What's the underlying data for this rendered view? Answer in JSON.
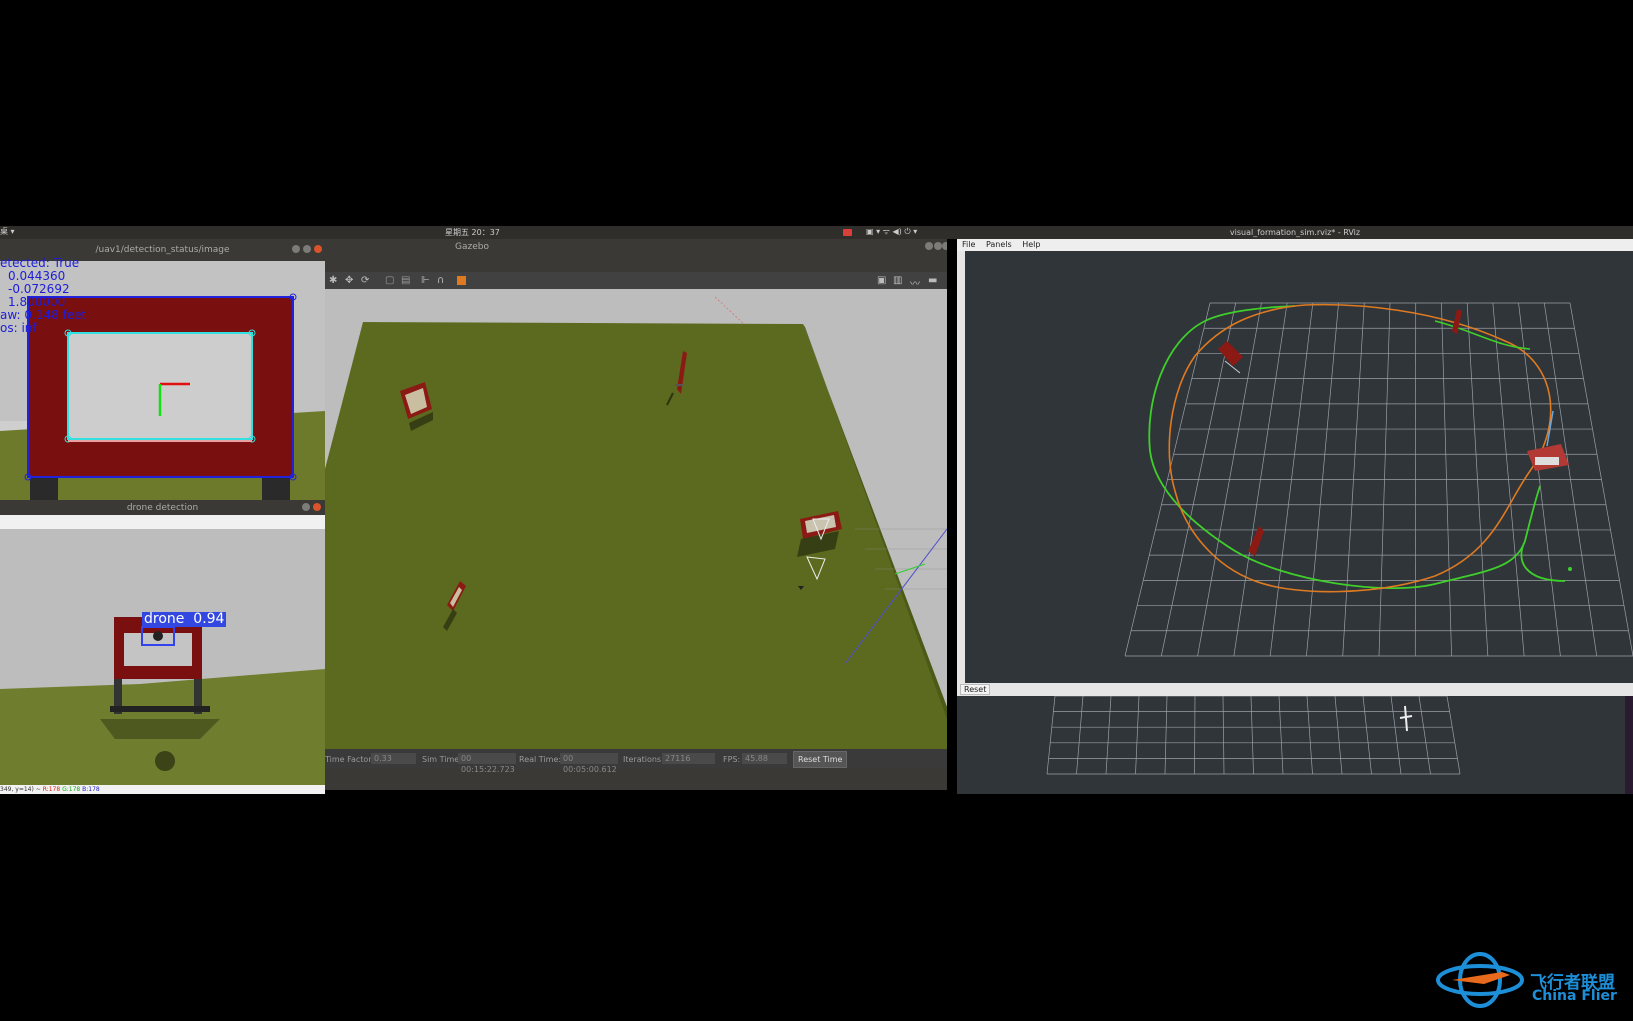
{
  "topbar": {
    "left_menu": "桌 ▾",
    "clock": "星期五 20：37",
    "tray_glyphs": "▣ ▾  ᯤ ◀) ⏻ ▾"
  },
  "detection_window": {
    "title": "/uav1/detection_status/image",
    "lines": [
      "etected: True",
      "0.044360",
      "-0.072692",
      "1.800000",
      "aw: 0.148 feet",
      "os: inf"
    ]
  },
  "drone_window": {
    "title": "drone detection",
    "label": "drone  0.94",
    "status_prefix": "349, y=14) ~",
    "status_r": "R:178",
    "status_g": "G:178",
    "status_b": "B:178"
  },
  "gazebo": {
    "title": "Gazebo",
    "footer": {
      "time_factor_label": "Time Factor:",
      "time_factor": "0.33",
      "sim_time_label": "Sim Time:",
      "sim_time": "00 00:15:22.723",
      "real_time_label": "Real Time:",
      "real_time": "00 00:05:00.612",
      "iterations_label": "Iterations:",
      "iterations": "27116",
      "fps_label": "FPS:",
      "fps": "45.88",
      "reset_time": "Reset Time"
    }
  },
  "rviz": {
    "title": "visual_formation_sim.rviz* - RViz",
    "menu": [
      "File",
      "Panels",
      "Help"
    ],
    "reset": "Reset"
  },
  "watermark": {
    "cn": "飞行者联盟",
    "en": "China Flier"
  },
  "colors": {
    "gate_red": "#8c1a14",
    "grass": "#5e6e1f",
    "rviz_bg": "#30353a",
    "traj_green": "#3fcf2a",
    "traj_orange": "#e07a20"
  }
}
